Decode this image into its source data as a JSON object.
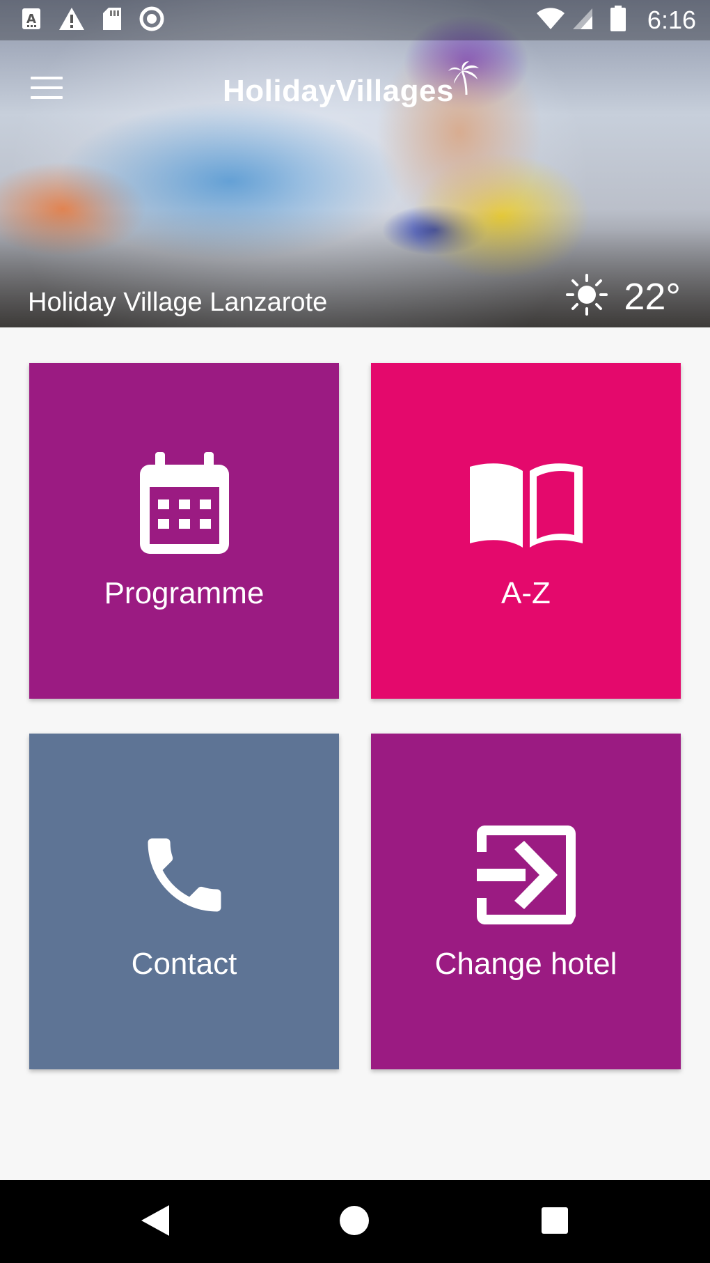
{
  "status_bar": {
    "time": "6:16",
    "left_icons": [
      "accessibility-a-icon",
      "warning-icon",
      "sd-card-icon",
      "record-circle-icon"
    ],
    "right_icons": [
      "wifi-icon",
      "signal-icon",
      "battery-icon"
    ]
  },
  "header": {
    "brand": "HolidayVillages",
    "hotel_name": "Holiday Village Lanzarote",
    "weather": {
      "icon": "sun-icon",
      "temperature": "22°"
    }
  },
  "tiles": [
    {
      "label": "Programme",
      "icon": "calendar-icon",
      "color": "#9b1b82"
    },
    {
      "label": "A-Z",
      "icon": "open-book-icon",
      "color": "#e4096c"
    },
    {
      "label": "Contact",
      "icon": "phone-icon",
      "color": "#5e7495"
    },
    {
      "label": "Change hotel",
      "icon": "exit-arrow-icon",
      "color": "#9b1b82"
    }
  ],
  "nav_bar": {
    "buttons": [
      "back-icon",
      "home-icon",
      "recents-icon"
    ]
  }
}
